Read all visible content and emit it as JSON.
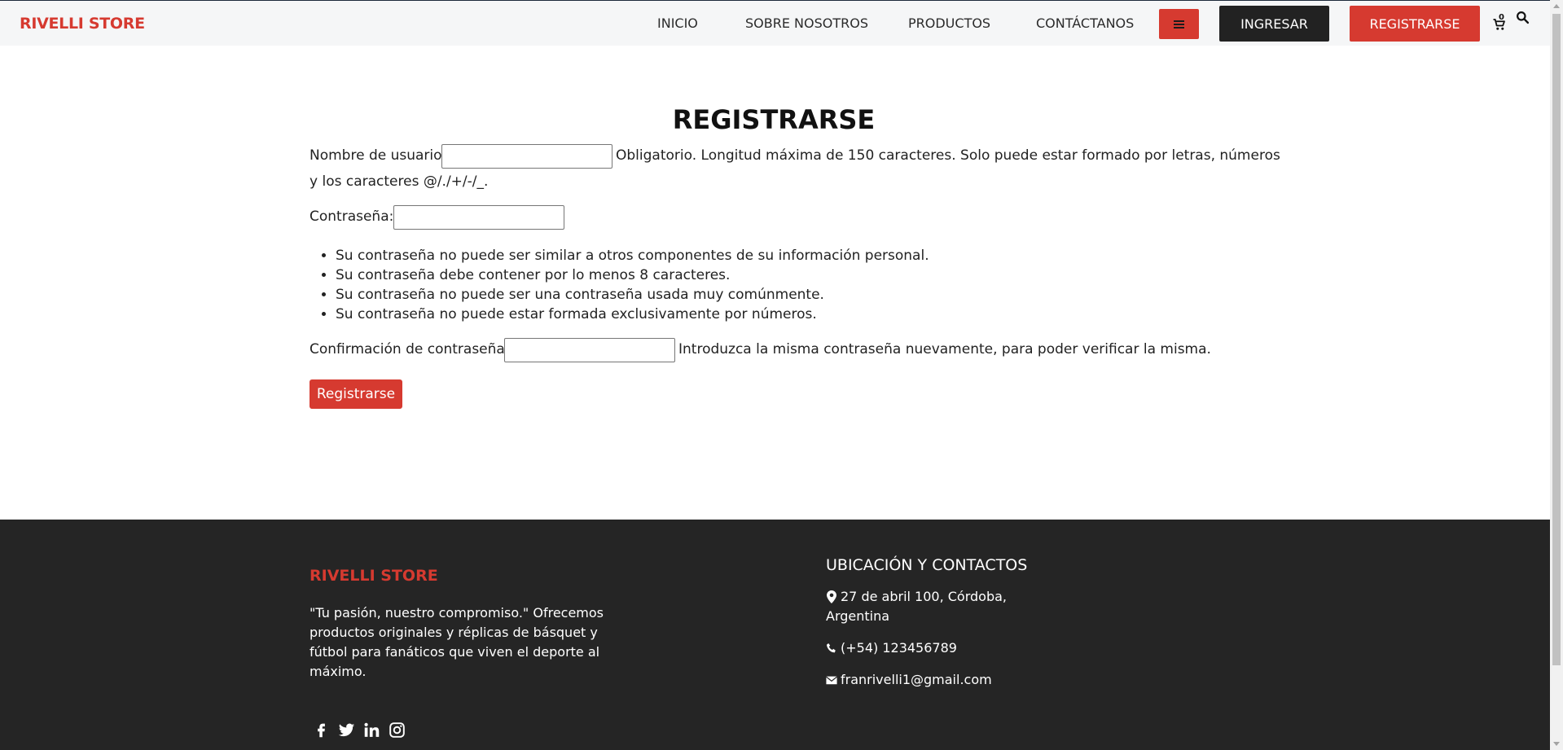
{
  "header": {
    "brand": "RIVELLI STORE",
    "nav": [
      "INICIO",
      "SOBRE NOSOTROS",
      "PRODUCTOS",
      "CONTÁCTANOS"
    ],
    "login_label": "INGRESAR",
    "register_label": "REGISTRARSE",
    "cart_count": "0",
    "icons": {
      "menu": "hamburger-icon",
      "cart": "cart-icon",
      "search": "search-icon"
    }
  },
  "form": {
    "title": "REGISTRARSE",
    "username_label": "Nombre de usuario:",
    "username_value": "",
    "username_help_1": "Obligatorio. Longitud máxima de 150 caracteres. Solo puede estar formado por letras, números",
    "username_help_2": "y los caracteres @/./+/-/_.",
    "password_label": "Contraseña:",
    "password_value": "",
    "password_rules": [
      "Su contraseña no puede ser similar a otros componentes de su información personal.",
      "Su contraseña debe contener por lo menos 8 caracteres.",
      "Su contraseña no puede ser una contraseña usada muy comúnmente.",
      "Su contraseña no puede estar formada exclusivamente por números."
    ],
    "confirm_label": "Confirmación de contraseña:",
    "confirm_value": "",
    "confirm_help": "Introduzca la misma contraseña nuevamente, para poder verificar la misma.",
    "submit_label": "Registrarse"
  },
  "footer": {
    "brand": "RIVELLI STORE",
    "tagline": "\"Tu pasión, nuestro compromiso.\" Ofrecemos productos originales y réplicas de básquet y fútbol para fanáticos que viven el deporte al máximo.",
    "contact_heading": "UBICACIÓN Y CONTACTOS",
    "address_line1": "27 de abril 100, Córdoba,",
    "address_line2": "Argentina",
    "phone": "(+54) 123456789",
    "email": "franrivelli1@gmail.com",
    "social_icons": [
      "facebook-icon",
      "twitter-icon",
      "linkedin-icon",
      "instagram-icon"
    ]
  },
  "colors": {
    "accent": "#d63a30",
    "dark": "#222222",
    "footer_bg": "#252525",
    "header_bg": "#f5f6f7"
  }
}
